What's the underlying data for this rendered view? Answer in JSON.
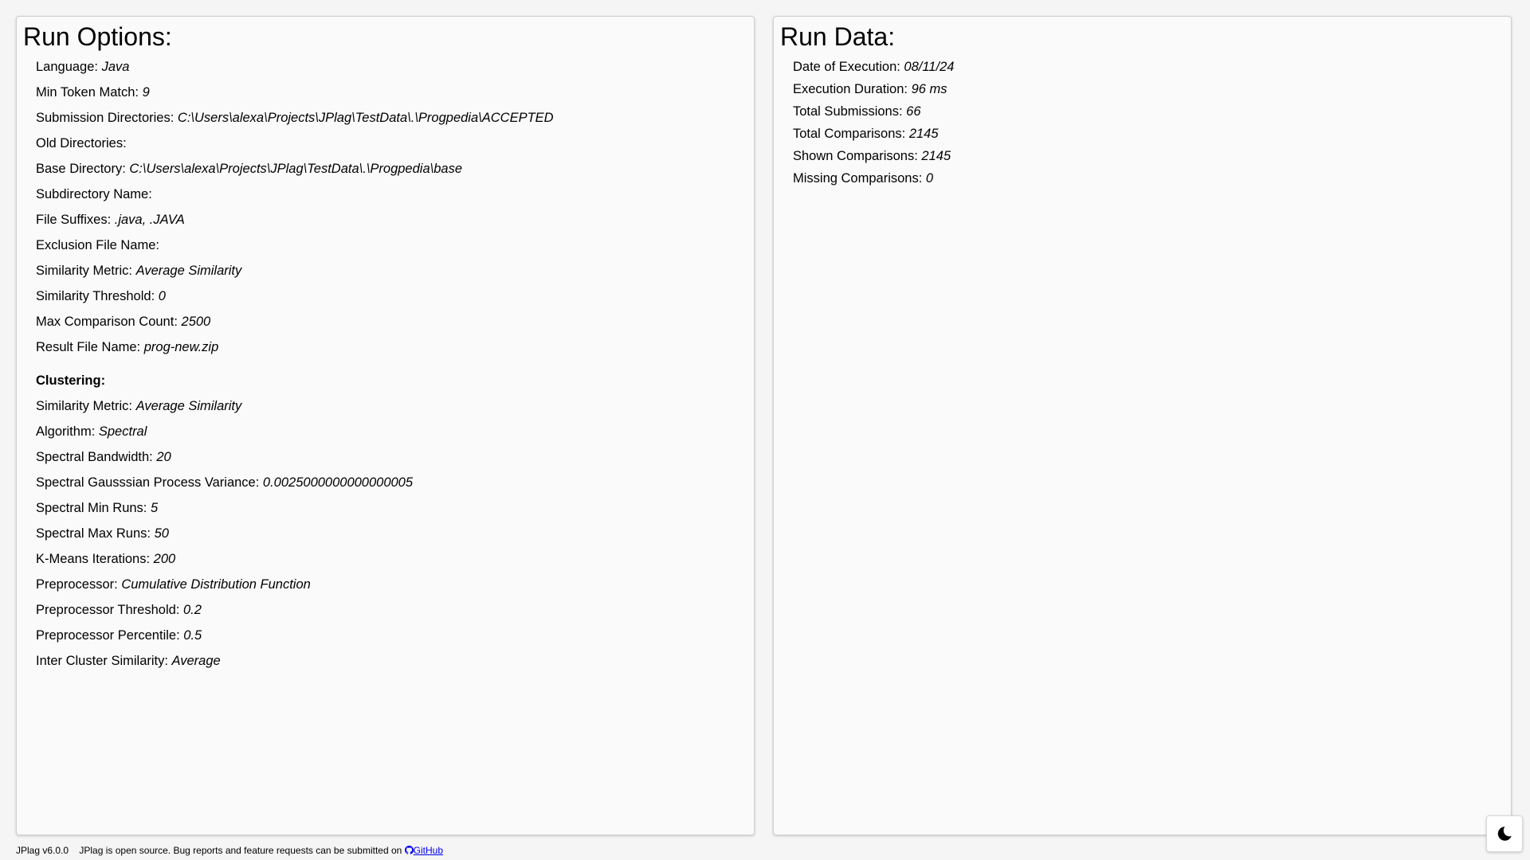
{
  "run_options": {
    "title": "Run Options:",
    "rows": [
      {
        "label": "Language:",
        "value": "Java"
      },
      {
        "label": "Min Token Match:",
        "value": "9"
      },
      {
        "label": "Submission Directories:",
        "value": "C:\\Users\\alexa\\Projects\\JPlag\\TestData\\.\\Progpedia\\ACCEPTED"
      },
      {
        "label": "Old Directories:",
        "value": ""
      },
      {
        "label": "Base Directory:",
        "value": "C:\\Users\\alexa\\Projects\\JPlag\\TestData\\.\\Progpedia\\base"
      },
      {
        "label": "Subdirectory Name:",
        "value": ""
      },
      {
        "label": "File Suffixes:",
        "value": ".java, .JAVA"
      },
      {
        "label": "Exclusion File Name:",
        "value": ""
      },
      {
        "label": "Similarity Metric:",
        "value": "Average Similarity"
      },
      {
        "label": "Similarity Threshold:",
        "value": "0"
      },
      {
        "label": "Max Comparison Count:",
        "value": "2500"
      },
      {
        "label": "Result File Name:",
        "value": "prog-new.zip"
      }
    ],
    "clustering_title": "Clustering:",
    "clustering_rows": [
      {
        "label": "Similarity Metric:",
        "value": "Average Similarity"
      },
      {
        "label": "Algorithm:",
        "value": "Spectral"
      },
      {
        "label": "Spectral Bandwidth:",
        "value": "20"
      },
      {
        "label": "Spectral Gausssian Process Variance:",
        "value": "0.0025000000000000005"
      },
      {
        "label": "Spectral Min Runs:",
        "value": "5"
      },
      {
        "label": "Spectral Max Runs:",
        "value": "50"
      },
      {
        "label": "K-Means Iterations:",
        "value": "200"
      },
      {
        "label": "Preprocessor:",
        "value": "Cumulative Distribution Function"
      },
      {
        "label": "Preprocessor Threshold:",
        "value": "0.2"
      },
      {
        "label": "Preprocessor Percentile:",
        "value": "0.5"
      },
      {
        "label": "Inter Cluster Similarity:",
        "value": "Average"
      }
    ]
  },
  "run_data": {
    "title": "Run Data:",
    "rows": [
      {
        "label": "Date of Execution:",
        "value": "08/11/24"
      },
      {
        "label": "Execution Duration:",
        "value": "96 ms"
      },
      {
        "label": "Total Submissions:",
        "value": "66"
      },
      {
        "label": "Total Comparisons:",
        "value": "2145"
      },
      {
        "label": "Shown Comparisons:",
        "value": "2145"
      },
      {
        "label": "Missing Comparisons:",
        "value": "0"
      }
    ]
  },
  "footer": {
    "version": "JPlag v6.0.0",
    "message": "JPlag is open source. Bug reports and feature requests can be submitted on",
    "link_label": "GitHub",
    "link_icon": "github-icon"
  },
  "theme_toggle": {
    "icon": "moon-icon"
  },
  "colors": {
    "background": "#f5f5f5",
    "panel": "#fafafa",
    "link": "#0000ee"
  }
}
